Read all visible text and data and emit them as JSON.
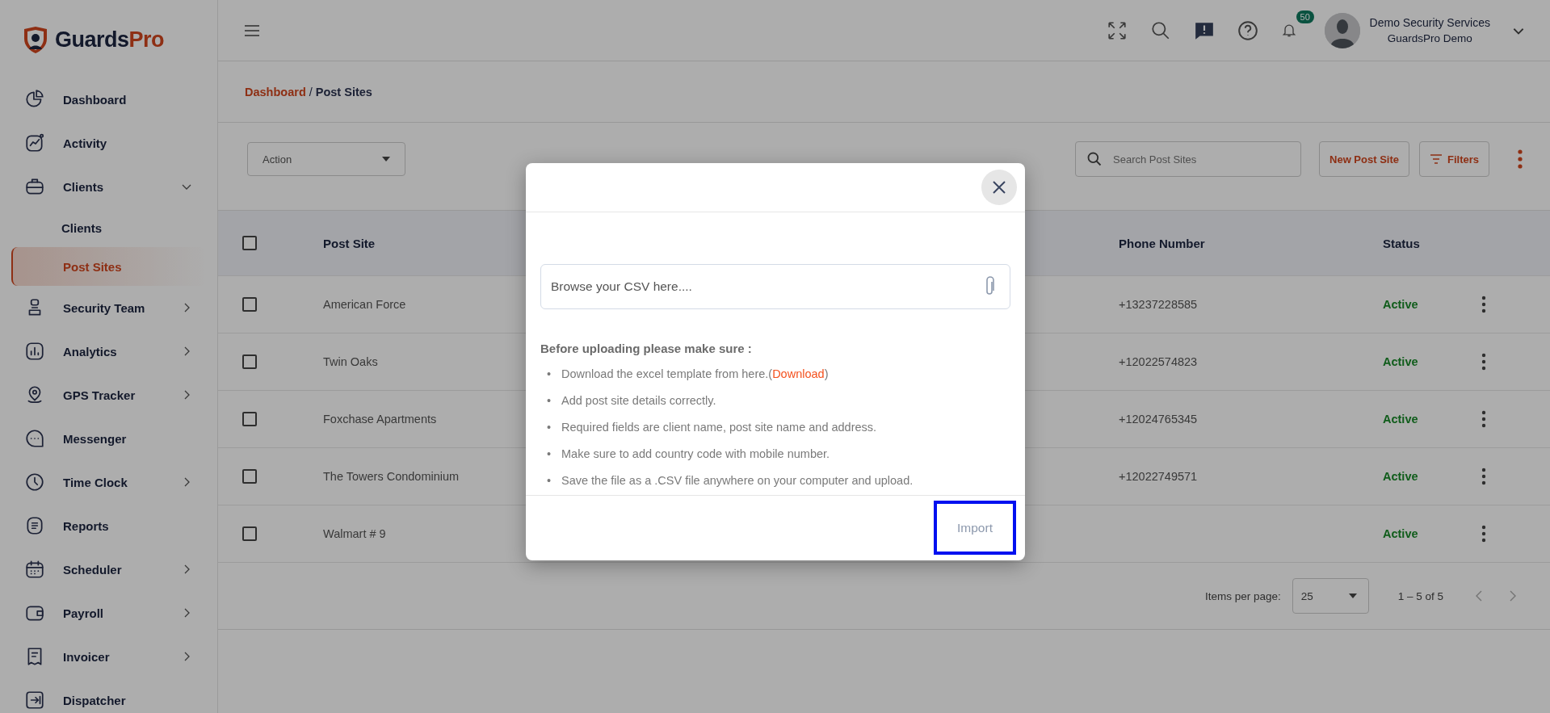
{
  "brand": {
    "name_main": "Guards",
    "name_accent": "Pro"
  },
  "sidebar": {
    "items": [
      {
        "label": "Dashboard",
        "selected": false
      },
      {
        "label": "Activity",
        "selected": false
      },
      {
        "label": "Clients",
        "selected": false,
        "expanded": true,
        "children": [
          {
            "label": "Clients",
            "selected": false
          },
          {
            "label": "Post Sites",
            "selected": true
          }
        ]
      },
      {
        "label": "Security Team",
        "selected": false,
        "expanded": false
      },
      {
        "label": "Analytics",
        "selected": false,
        "expanded": false
      },
      {
        "label": "GPS Tracker",
        "selected": false,
        "expanded": false
      },
      {
        "label": "Messenger",
        "selected": false
      },
      {
        "label": "Time Clock",
        "selected": false,
        "expanded": false
      },
      {
        "label": "Reports",
        "selected": false
      },
      {
        "label": "Scheduler",
        "selected": false,
        "expanded": false
      },
      {
        "label": "Payroll",
        "selected": false,
        "expanded": false
      },
      {
        "label": "Invoicer",
        "selected": false,
        "expanded": false
      },
      {
        "label": "Dispatcher",
        "selected": false
      }
    ]
  },
  "header": {
    "notification_count": "50",
    "user": {
      "name": "Demo Security Services",
      "company": "GuardsPro Demo"
    }
  },
  "breadcrumb": [
    {
      "label": "Dashboard",
      "kind": "link"
    },
    {
      "label": "/",
      "kind": "separator"
    },
    {
      "label": "Post Sites",
      "kind": "current"
    }
  ],
  "toolbar": {
    "action_select": {
      "value": "Action"
    },
    "search": {
      "placeholder": "Search Post Sites"
    },
    "new_button": "New Post Site",
    "filters_button": "Filters"
  },
  "table": {
    "header_checked": false,
    "columns": [
      "Post Site",
      "Phone Number",
      "Status"
    ],
    "rows": [
      {
        "post_site": "American Force",
        "phone": "+13237228585",
        "status": "Active",
        "checked": false
      },
      {
        "post_site": "Twin Oaks",
        "phone": "+12022574823",
        "status": "Active",
        "checked": false
      },
      {
        "post_site": "Foxchase Apartments",
        "phone": "+12024765345",
        "status": "Active",
        "checked": false
      },
      {
        "post_site": "The Towers Condominium",
        "phone": "+12022749571",
        "status": "Active",
        "checked": false
      },
      {
        "post_site": "Walmart # 9",
        "status": "Active",
        "checked": false
      }
    ]
  },
  "pagination": {
    "label": "Items per page:",
    "page_size": "25",
    "range": "1 – 5 of 5"
  },
  "modal": {
    "file_field": {
      "placeholder": "Browse your CSV here...."
    },
    "instructions_title": "Before uploading please make sure :",
    "instructions": [
      {
        "marker": "•",
        "text": "Download the excel template from here.(",
        "link": "Download",
        "suffix": ")"
      },
      {
        "marker": "•",
        "text": "Add post site details correctly."
      },
      {
        "marker": "•",
        "text": "Required fields are client name, post site name and address."
      },
      {
        "marker": "•",
        "text": "Make sure to add country code with mobile number."
      },
      {
        "marker": "•",
        "text": "Save the file as a .CSV file anywhere on your computer and upload."
      }
    ],
    "import_button": {
      "label": "Import",
      "disabled": true,
      "focused": true
    }
  }
}
